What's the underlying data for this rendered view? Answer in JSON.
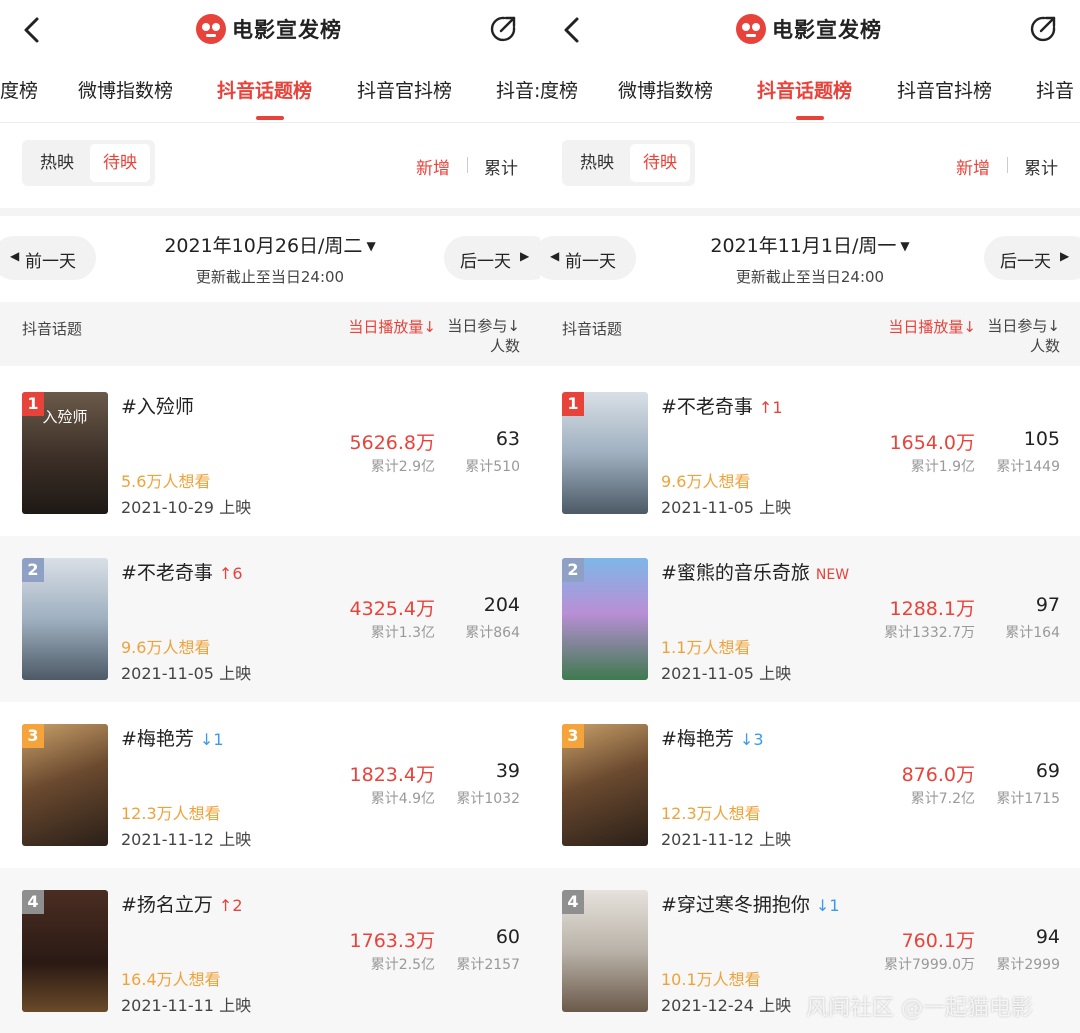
{
  "colors": {
    "accent": "#e8433b",
    "want": "#f0a23a",
    "down": "#3a9be8"
  },
  "panels": [
    {
      "header": {
        "title": "电影宣发榜"
      },
      "tabs": [
        {
          "label": "度榜",
          "active": false
        },
        {
          "label": "微博指数榜",
          "active": false
        },
        {
          "label": "抖音话题榜",
          "active": true
        },
        {
          "label": "抖音官抖榜",
          "active": false
        },
        {
          "label": "抖音:",
          "active": false
        }
      ],
      "segment": {
        "option1": "热映",
        "option2": "待映",
        "selected": "待映"
      },
      "mode": {
        "new_label": "新增",
        "total_label": "累计",
        "selected": "新增"
      },
      "date_nav": {
        "prev": "前一天",
        "next": "后一天",
        "date": "2021年10月26日/周二",
        "update": "更新截止至当日24:00"
      },
      "columns": {
        "topic": "抖音话题",
        "play": "当日播放量↓",
        "join_line1": "当日参与↓",
        "join_line2": "人数"
      },
      "rows": [
        {
          "rank": "1",
          "title": "#入殓师",
          "trend": "",
          "trend_dir": "none",
          "want": "5.6万人想看",
          "release": "2021-10-29 上映",
          "play": "5626.8万",
          "play_total": "累计2.9亿",
          "join": "63",
          "join_total": "累计510"
        },
        {
          "rank": "2",
          "title": "#不老奇事",
          "trend": "↑6",
          "trend_dir": "up",
          "want": "9.6万人想看",
          "release": "2021-11-05 上映",
          "play": "4325.4万",
          "play_total": "累计1.3亿",
          "join": "204",
          "join_total": "累计864"
        },
        {
          "rank": "3",
          "title": "#梅艳芳",
          "trend": "↓1",
          "trend_dir": "down",
          "want": "12.3万人想看",
          "release": "2021-11-12 上映",
          "play": "1823.4万",
          "play_total": "累计4.9亿",
          "join": "39",
          "join_total": "累计1032"
        },
        {
          "rank": "4",
          "title": "#扬名立万",
          "trend": "↑2",
          "trend_dir": "up",
          "want": "16.4万人想看",
          "release": "2021-11-11 上映",
          "play": "1763.3万",
          "play_total": "累计2.5亿",
          "join": "60",
          "join_total": "累计2157"
        }
      ]
    },
    {
      "header": {
        "title": "电影宣发榜"
      },
      "tabs": [
        {
          "label": "度榜",
          "active": false
        },
        {
          "label": "微博指数榜",
          "active": false
        },
        {
          "label": "抖音话题榜",
          "active": true
        },
        {
          "label": "抖音官抖榜",
          "active": false
        },
        {
          "label": "抖音",
          "active": false
        }
      ],
      "segment": {
        "option1": "热映",
        "option2": "待映",
        "selected": "待映"
      },
      "mode": {
        "new_label": "新增",
        "total_label": "累计",
        "selected": "新增"
      },
      "date_nav": {
        "prev": "前一天",
        "next": "后一天",
        "date": "2021年11月1日/周一",
        "update": "更新截止至当日24:00"
      },
      "columns": {
        "topic": "抖音话题",
        "play": "当日播放量↓",
        "join_line1": "当日参与↓",
        "join_line2": "人数"
      },
      "rows": [
        {
          "rank": "1",
          "title": "#不老奇事",
          "trend": "↑1",
          "trend_dir": "up",
          "want": "9.6万人想看",
          "release": "2021-11-05 上映",
          "play": "1654.0万",
          "play_total": "累计1.9亿",
          "join": "105",
          "join_total": "累计1449"
        },
        {
          "rank": "2",
          "title": "#蜜熊的音乐奇旅",
          "trend": "NEW",
          "trend_dir": "new",
          "want": "1.1万人想看",
          "release": "2021-11-05 上映",
          "play": "1288.1万",
          "play_total": "累计1332.7万",
          "join": "97",
          "join_total": "累计164"
        },
        {
          "rank": "3",
          "title": "#梅艳芳",
          "trend": "↓3",
          "trend_dir": "down",
          "want": "12.3万人想看",
          "release": "2021-11-12 上映",
          "play": "876.0万",
          "play_total": "累计7.2亿",
          "join": "69",
          "join_total": "累计1715"
        },
        {
          "rank": "4",
          "title": "#穿过寒冬拥抱你",
          "trend": "↓1",
          "trend_dir": "down",
          "want": "10.1万人想看",
          "release": "2021-12-24 上映",
          "play": "760.1万",
          "play_total": "累计7999.0万",
          "join": "94",
          "join_total": "累计2999"
        }
      ]
    }
  ],
  "watermark": "风闻社区 @一起猫电影"
}
